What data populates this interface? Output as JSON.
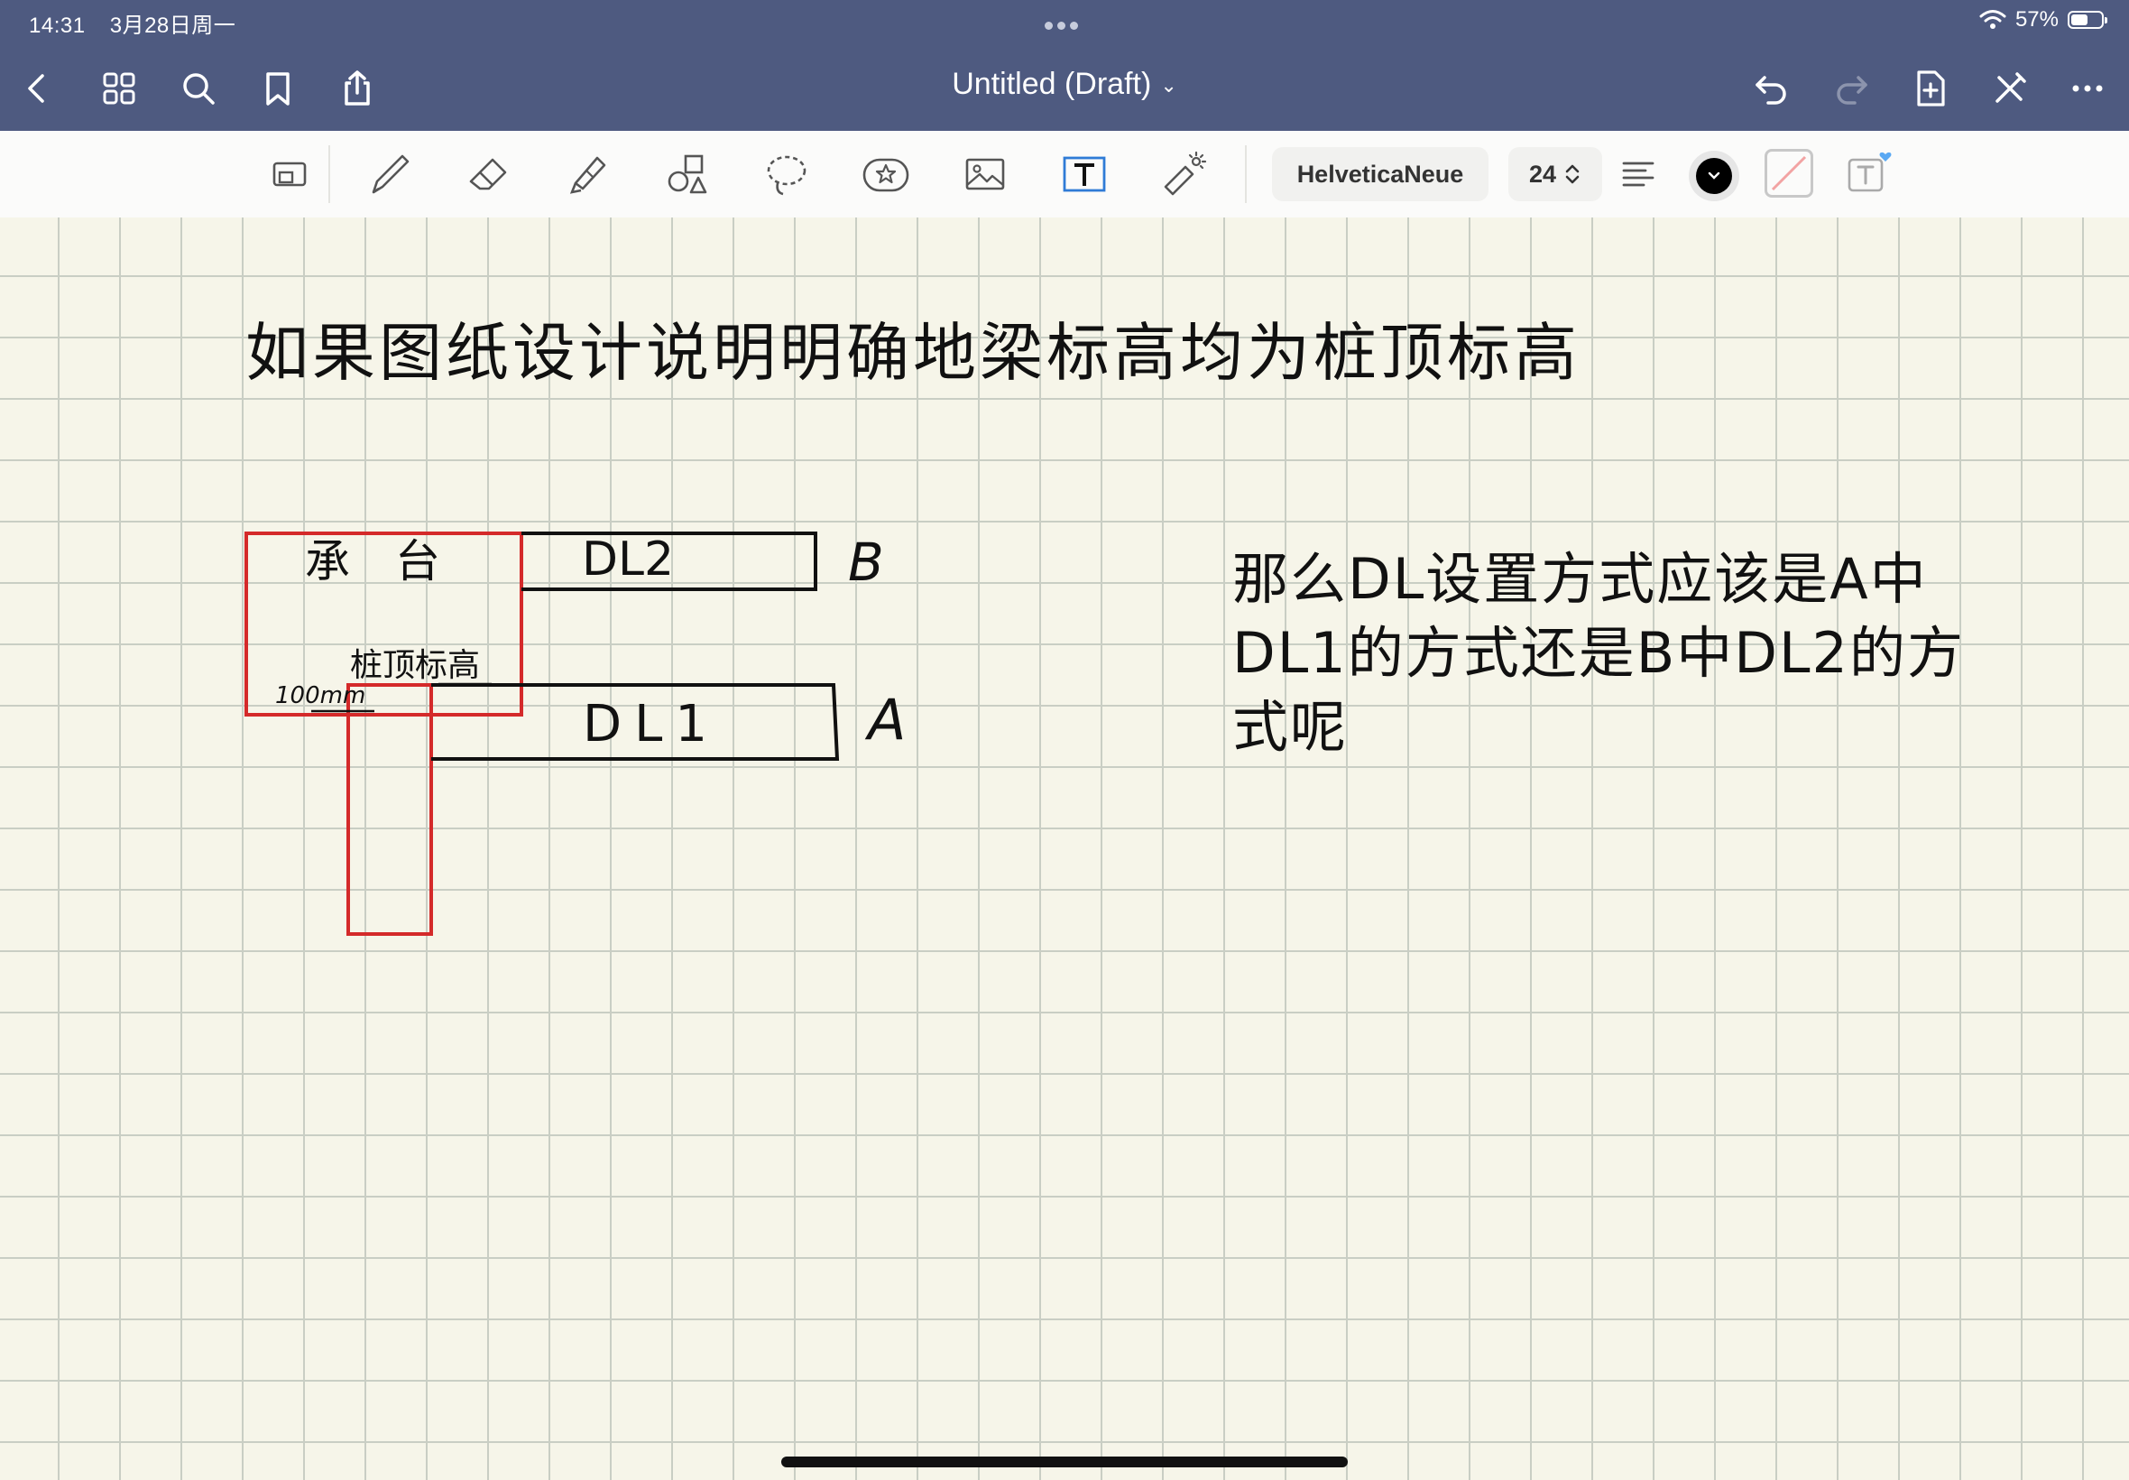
{
  "status_bar": {
    "time": "14:31",
    "date": "3月28日周一",
    "battery": "57%",
    "battery_level": 0.57
  },
  "nav": {
    "title": "Untitled (Draft)",
    "title_chevron": "⌄",
    "left_icons": [
      "back-chevron-icon",
      "grid-icon",
      "search-icon",
      "bookmark-icon",
      "share-icon"
    ],
    "right_icons": [
      "undo-icon",
      "redo-icon",
      "add-page-icon",
      "close-pen-icon",
      "more-icon"
    ]
  },
  "toolbar": {
    "tools": [
      "zoom-window-icon",
      "pen-icon",
      "eraser-icon",
      "highlighter-icon",
      "shapes-icon",
      "lasso-icon",
      "sticker-icon",
      "image-icon",
      "text-icon",
      "laser-pointer-icon"
    ],
    "active_tool": "text-icon",
    "font_name": "HelveticaNeue",
    "font_size": "24",
    "text_color": "#000000",
    "accent_color": "#2f7bd6"
  },
  "canvas": {
    "background": "#f6f5e9",
    "grid_color": "#c9cec4",
    "heading": "如果图纸设计说明明确地梁标高均为桩顶标高",
    "question_lines": [
      "那么DL设置方式应该是A中",
      "DL1的方式还是B中DL2的方",
      "式呢"
    ],
    "sketch": {
      "cap_label": "承　台",
      "pile_top_label": "桩顶标高",
      "offset_label": "100mm",
      "beam_upper_label": "DL2",
      "beam_lower_label": "DL1",
      "option_b": "B",
      "option_a": "A",
      "red_color": "#d42a2a",
      "ink_color": "#111111"
    }
  }
}
